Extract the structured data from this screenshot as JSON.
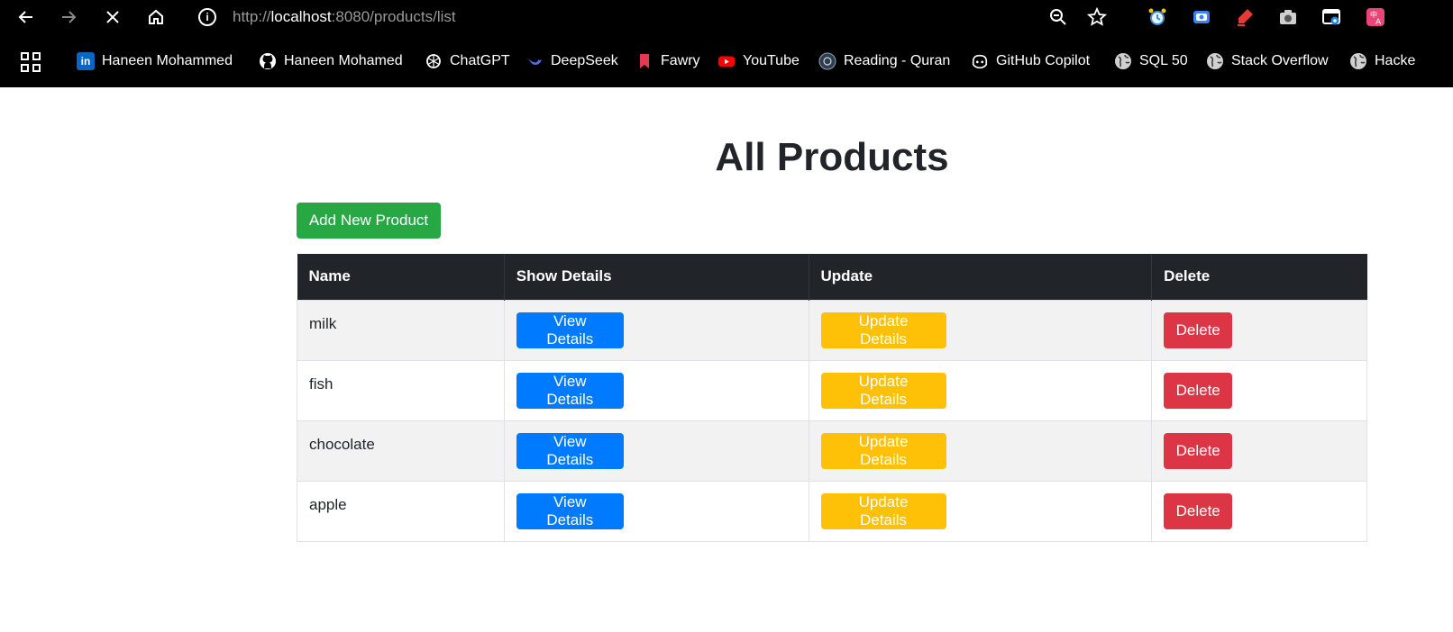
{
  "browser": {
    "url_scheme": "http://",
    "url_host": "localhost",
    "url_path": ":8080/products/list",
    "bookmarks": [
      {
        "label": "Haneen Mohammed",
        "icon": "linkedin-icon"
      },
      {
        "label": "Haneen Mohamed",
        "icon": "github-icon"
      },
      {
        "label": "ChatGPT",
        "icon": "chatgpt-icon"
      },
      {
        "label": "DeepSeek",
        "icon": "deepseek-icon"
      },
      {
        "label": "Fawry",
        "icon": "bookmark-icon"
      },
      {
        "label": "YouTube",
        "icon": "youtube-icon"
      },
      {
        "label": "Reading - Quran",
        "icon": "quran-icon"
      },
      {
        "label": "GitHub Copilot",
        "icon": "copilot-icon"
      },
      {
        "label": "SQL 50",
        "icon": "globe-icon"
      },
      {
        "label": "Stack Overflow",
        "icon": "globe-icon"
      },
      {
        "label": "Hacke",
        "icon": "globe-icon"
      }
    ]
  },
  "page": {
    "title": "All Products",
    "add_button": "Add New Product"
  },
  "table": {
    "headers": [
      "Name",
      "Show Details",
      "Update",
      "Delete"
    ],
    "rows": [
      {
        "name": "milk",
        "view": "View Details",
        "update": "Update Details",
        "delete": "Delete"
      },
      {
        "name": "fish",
        "view": "View Details",
        "update": "Update Details",
        "delete": "Delete"
      },
      {
        "name": "chocolate",
        "view": "View Details",
        "update": "Update Details",
        "delete": "Delete"
      },
      {
        "name": "apple",
        "view": "View Details",
        "update": "Update Details",
        "delete": "Delete"
      }
    ]
  },
  "colors": {
    "add": "#28a745",
    "view": "#007bff",
    "update": "#ffc107",
    "delete": "#dc3545",
    "header": "#212529"
  }
}
